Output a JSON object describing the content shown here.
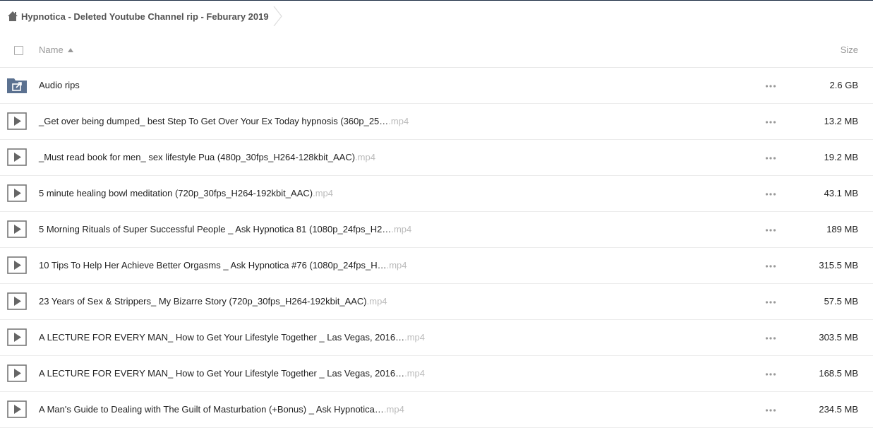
{
  "breadcrumb": {
    "title": "Hypnotica - Deleted Youtube Channel rip - Feburary 2019",
    "icon": "home-icon"
  },
  "header": {
    "name_label": "Name",
    "size_label": "Size",
    "sort_icon": "sort-ascending-icon"
  },
  "colors": {
    "folder": "#5b7190",
    "muted": "#999999",
    "extension": "#bbbbbb",
    "topline": "#1d2d44"
  },
  "rows": [
    {
      "type": "shared-folder",
      "name": "Audio rips",
      "ext": "",
      "size": "2.6 GB"
    },
    {
      "type": "video",
      "name": "_Get over being dumped_ best Step To Get Over Your Ex Today hypnosis (360p_25…",
      "ext": ".mp4",
      "size": "13.2 MB"
    },
    {
      "type": "video",
      "name": "_Must read book for men_ sex lifestyle Pua (480p_30fps_H264-128kbit_AAC)",
      "ext": ".mp4",
      "size": "19.2 MB"
    },
    {
      "type": "video",
      "name": "5 minute healing bowl meditation (720p_30fps_H264-192kbit_AAC)",
      "ext": ".mp4",
      "size": "43.1 MB"
    },
    {
      "type": "video",
      "name": "5 Morning Rituals of Super Successful People _ Ask Hypnotica 81 (1080p_24fps_H2…",
      "ext": ".mp4",
      "size": "189 MB"
    },
    {
      "type": "video",
      "name": "10 Tips To Help Her Achieve Better Orgasms _ Ask Hypnotica #76 (1080p_24fps_H…",
      "ext": ".mp4",
      "size": "315.5 MB"
    },
    {
      "type": "video",
      "name": "23 Years of Sex & Strippers_ My Bizarre Story (720p_30fps_H264-192kbit_AAC)",
      "ext": ".mp4",
      "size": "57.5 MB"
    },
    {
      "type": "video",
      "name": "A LECTURE FOR EVERY MAN_ How to Get Your Lifestyle Together _ Las Vegas, 2016…",
      "ext": ".mp4",
      "size": "303.5 MB"
    },
    {
      "type": "video",
      "name": "A LECTURE FOR EVERY MAN_ How to Get Your Lifestyle Together _ Las Vegas, 2016…",
      "ext": ".mp4",
      "size": "168.5 MB"
    },
    {
      "type": "video",
      "name": "A Man's Guide to Dealing with The Guilt of Masturbation (+Bonus) _ Ask Hypnotica…",
      "ext": ".mp4",
      "size": "234.5 MB"
    }
  ]
}
